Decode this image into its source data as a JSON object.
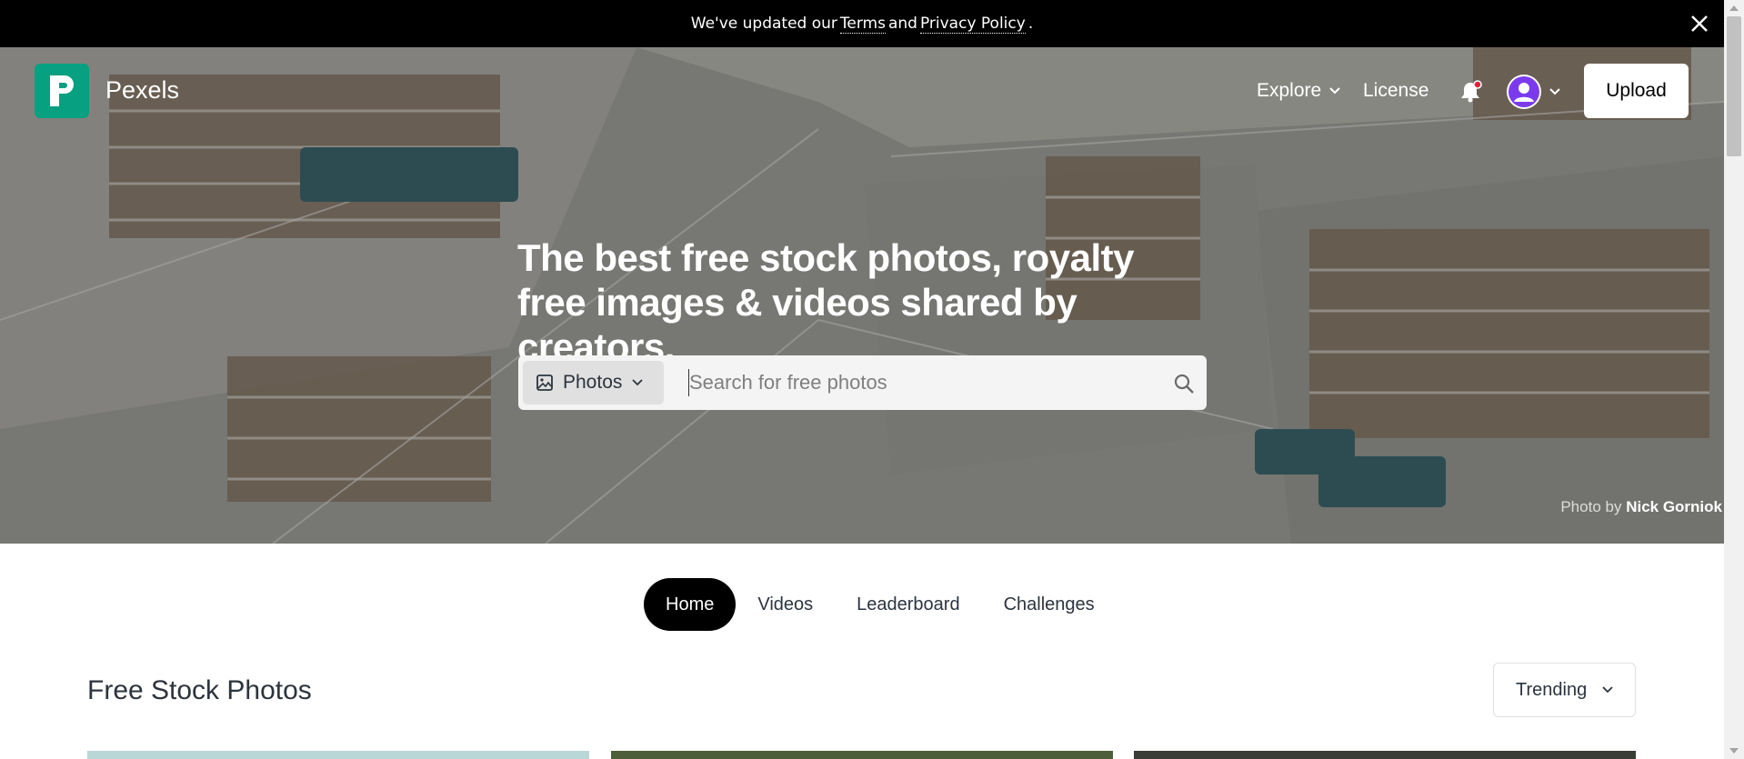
{
  "notice": {
    "prefix": "We've updated our",
    "terms": "Terms",
    "and": "and",
    "privacy": "Privacy Policy",
    "suffix": "."
  },
  "header": {
    "brand": "Pexels",
    "explore": "Explore",
    "license": "License",
    "upload": "Upload"
  },
  "hero": {
    "headline": "The best free stock photos, royalty free images & videos shared by creators.",
    "search": {
      "type_label": "Photos",
      "placeholder": "Search for free photos"
    },
    "credit_prefix": "Photo by",
    "credit_name": "Nick Gorniok"
  },
  "tabs": [
    {
      "label": "Home"
    },
    {
      "label": "Videos"
    },
    {
      "label": "Leaderboard"
    },
    {
      "label": "Challenges"
    }
  ],
  "main": {
    "section_title": "Free Stock Photos",
    "sort_label": "Trending"
  },
  "colors": {
    "brand": "#07a081",
    "notification_dot": "#e3213b",
    "avatar": "#7c3aed"
  }
}
